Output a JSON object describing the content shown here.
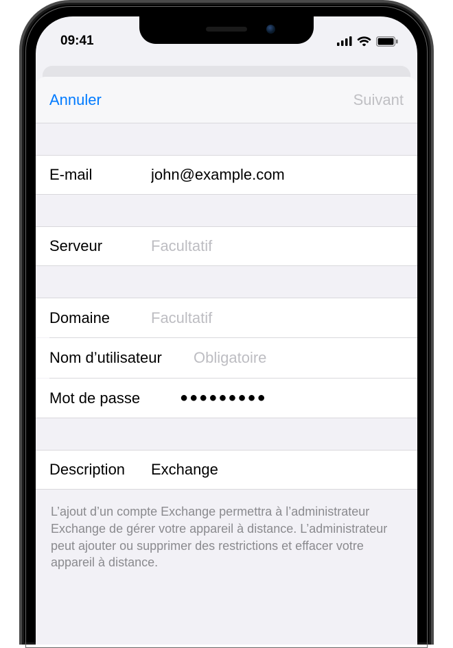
{
  "status": {
    "time": "09:41"
  },
  "nav": {
    "cancel": "Annuler",
    "next": "Suivant"
  },
  "fields": {
    "email": {
      "label": "E-mail",
      "value": "john@example.com"
    },
    "server": {
      "label": "Serveur",
      "placeholder": "Facultatif",
      "value": ""
    },
    "domain": {
      "label": "Domaine",
      "placeholder": "Facultatif",
      "value": ""
    },
    "username": {
      "label": "Nom d’utilisateur",
      "placeholder": "Obligatoire",
      "value": ""
    },
    "password": {
      "label": "Mot de passe",
      "masked": "●●●●●●●●●"
    },
    "description": {
      "label": "Description",
      "value": "Exchange"
    }
  },
  "footer": "L’ajout d’un compte Exchange permettra à l’administrateur Exchange de gérer votre appareil à distance. L’administrateur peut ajouter ou supprimer des restrictions et effacer votre appareil à distance."
}
